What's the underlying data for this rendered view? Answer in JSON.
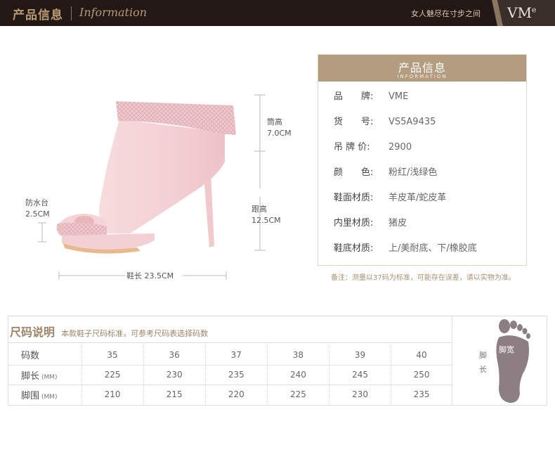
{
  "header": {
    "title_cn": "产品信息",
    "title_en": "Information",
    "slogan": "女人魅尽在寸步之间",
    "logo": "VM",
    "logo_sup": "e"
  },
  "shoe": {
    "dimensions": {
      "shaft_label": "筒高",
      "shaft_value": "7.0CM",
      "heel_label": "跟高",
      "heel_value": "12.5CM",
      "platform_label": "防水台",
      "platform_value": "2.5CM",
      "length_label": "鞋长 23.5CM"
    },
    "colors": {
      "leather": "#f3d3d6",
      "snake": "#eec3c8",
      "sole": "#e8b98c"
    }
  },
  "info": {
    "head_cn": "产品信息",
    "head_en": "INFORMATION",
    "rows": [
      {
        "label": "品　　牌:",
        "value": "VME"
      },
      {
        "label": "货　　号:",
        "value": "VS5A9435"
      },
      {
        "label": "吊 牌 价:",
        "value": "2900"
      },
      {
        "label": "颜　　色:",
        "value": "粉红/浅绿色"
      },
      {
        "label": "鞋面材质:",
        "value": "羊皮革/蛇皮革"
      },
      {
        "label": "内里材质:",
        "value": "猪皮"
      },
      {
        "label": "鞋底材质:",
        "value": "上/美耐底、下/橡胶底"
      }
    ],
    "note": "备注：测量以37码为标准，可能存在误差，请以实物为准。"
  },
  "size": {
    "title": "尺码说明",
    "desc": "本款鞋子尺码标准，可参考尺码表选择码数",
    "rows": [
      {
        "label": "码数",
        "unit": "",
        "values": [
          "35",
          "36",
          "37",
          "38",
          "39",
          "40"
        ]
      },
      {
        "label": "脚长",
        "unit": "(MM)",
        "values": [
          "225",
          "230",
          "235",
          "240",
          "245",
          "250"
        ]
      },
      {
        "label": "脚围",
        "unit": "(MM)",
        "values": [
          "210",
          "215",
          "220",
          "225",
          "230",
          "235"
        ]
      }
    ],
    "foot_length_label": "脚长",
    "foot_width_label": "脚宽"
  }
}
